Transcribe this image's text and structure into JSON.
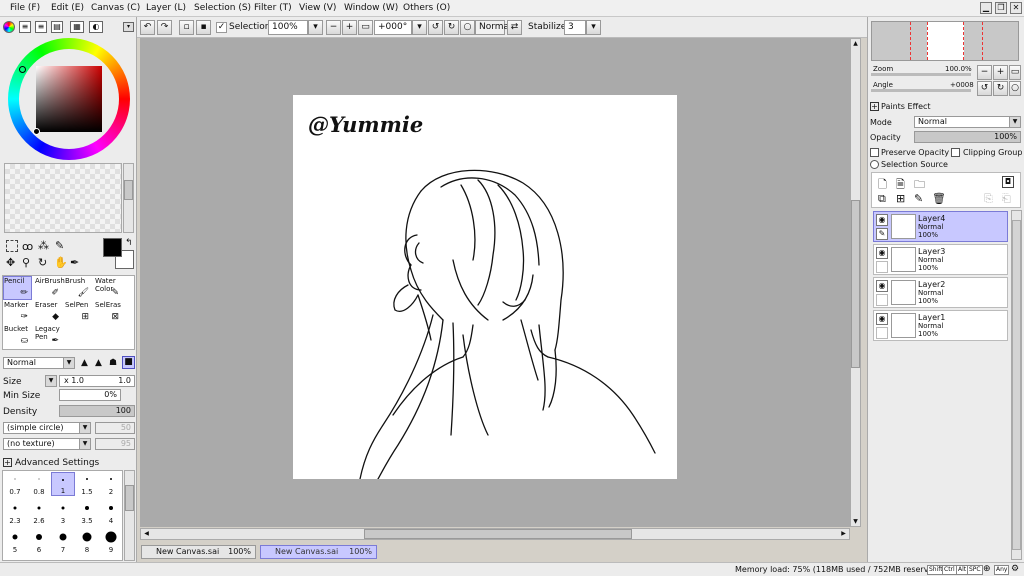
{
  "menu": {
    "items": [
      "File (F)",
      "Edit (E)",
      "Canvas (C)",
      "Layer (L)",
      "Selection (S)",
      "Filter (T)",
      "View (V)",
      "Window (W)",
      "Others (O)"
    ]
  },
  "toolbar": {
    "selection_label": "Selection",
    "zoom_value": "100%",
    "angle_value": "+000°",
    "blend_mode": "Normal",
    "stabilizer_label": "Stabilizer",
    "stabilizer_value": "3"
  },
  "tools": {
    "row1": [
      "Pencil",
      "AirBrush",
      "Brush",
      "Water Color"
    ],
    "row2": [
      "Marker",
      "Eraser",
      "SelPen",
      "SelEras"
    ],
    "row3": [
      "Bucket",
      "Legacy Pen"
    ]
  },
  "brush": {
    "mode": "Normal",
    "size_label": "Size",
    "size_mult": "x 1.0",
    "size_value": "1.0",
    "min_size_label": "Min Size",
    "min_size_value": "0%",
    "density_label": "Density",
    "density_value": "100",
    "shape": "(simple circle)",
    "shape_value": "50",
    "texture": "(no texture)",
    "texture_value": "95",
    "advanced_label": "Advanced Settings",
    "sizes": [
      "0.7",
      "0.8",
      "1",
      "1.5",
      "2",
      "2.3",
      "2.6",
      "3",
      "3.5",
      "4",
      "5",
      "6",
      "7",
      "8",
      "9"
    ]
  },
  "canvas": {
    "watermark": "@Yummie"
  },
  "navigator": {
    "zoom_label": "Zoom",
    "zoom_value": "100.0%",
    "angle_label": "Angle",
    "angle_value": "+0008"
  },
  "effects": {
    "paints_effect_label": "Paints Effect",
    "mode_label": "Mode",
    "mode_value": "Normal",
    "opacity_label": "Opacity",
    "opacity_value": "100%",
    "preserve_opacity": "Preserve Opacity",
    "clipping_group": "Clipping Group",
    "selection_source": "Selection Source"
  },
  "layers": [
    {
      "name": "Layer4",
      "mode": "Normal",
      "opacity": "100%"
    },
    {
      "name": "Layer3",
      "mode": "Normal",
      "opacity": "100%"
    },
    {
      "name": "Layer2",
      "mode": "Normal",
      "opacity": "100%"
    },
    {
      "name": "Layer1",
      "mode": "Normal",
      "opacity": "100%"
    }
  ],
  "tabs": [
    {
      "name": "New Canvas.sai",
      "zoom": "100%"
    },
    {
      "name": "New Canvas.sai",
      "zoom": "100%"
    }
  ],
  "status": {
    "memory": "Memory load: 75% (118MB used / 752MB reserved)",
    "keys": [
      "Shift",
      "Ctrl",
      "Alt",
      "SPC",
      "Any"
    ]
  },
  "colors": {
    "primary": "#000000",
    "secondary": "#ffffff",
    "picker_hue": "#cc0000",
    "selection": "#c8c8ff"
  }
}
